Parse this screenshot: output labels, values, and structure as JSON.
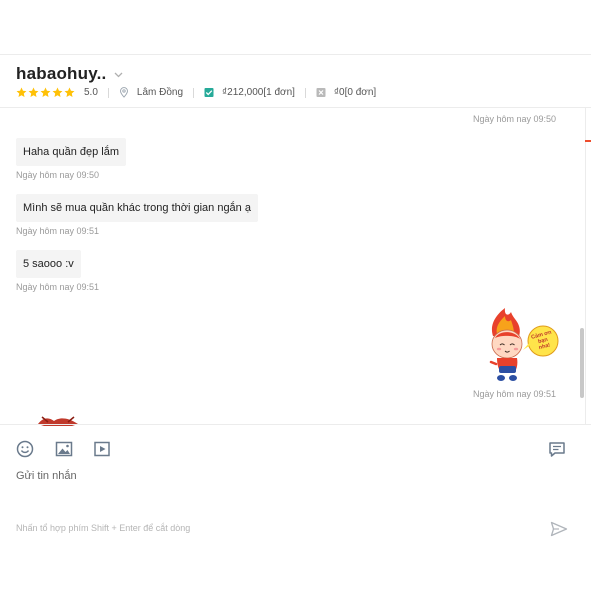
{
  "header": {
    "shop_name": "habaohuy..",
    "rating": "5.0",
    "location": "Lâm Đồng",
    "spent": "₫212,000[1 đơn]",
    "refunded": "₫0[0 đơn]"
  },
  "colors": {
    "star": "#ffc107",
    "accent": "#ee4d2d",
    "check": "#26aa99",
    "icon": "#6a7a8c"
  },
  "messages": [
    {
      "side": "right",
      "kind": "timestamp-only",
      "time": "Ngày hôm nay 09:50"
    },
    {
      "side": "left",
      "kind": "text",
      "text": "Haha quần đẹp lắm",
      "time": "Ngày hôm nay 09:50"
    },
    {
      "side": "left",
      "kind": "text",
      "text": "Mình sẽ mua quần khác trong thời gian ngắn ạ",
      "time": "Ngày hôm nay 09:51"
    },
    {
      "side": "left",
      "kind": "text",
      "text": "5 saooo :v",
      "time": "Ngày hôm nay 09:51"
    },
    {
      "side": "right",
      "kind": "sticker",
      "sticker_text": "Cảm ơn bạn nha!",
      "time": "Ngày hôm nay 09:51"
    }
  ],
  "composer": {
    "tools": [
      "emoji-icon",
      "image-icon",
      "video-icon",
      "quick-reply-icon"
    ],
    "placeholder": "Gửi tin nhắn",
    "hint": "Nhấn tổ hợp phím Shift + Enter để cắt dòng"
  }
}
